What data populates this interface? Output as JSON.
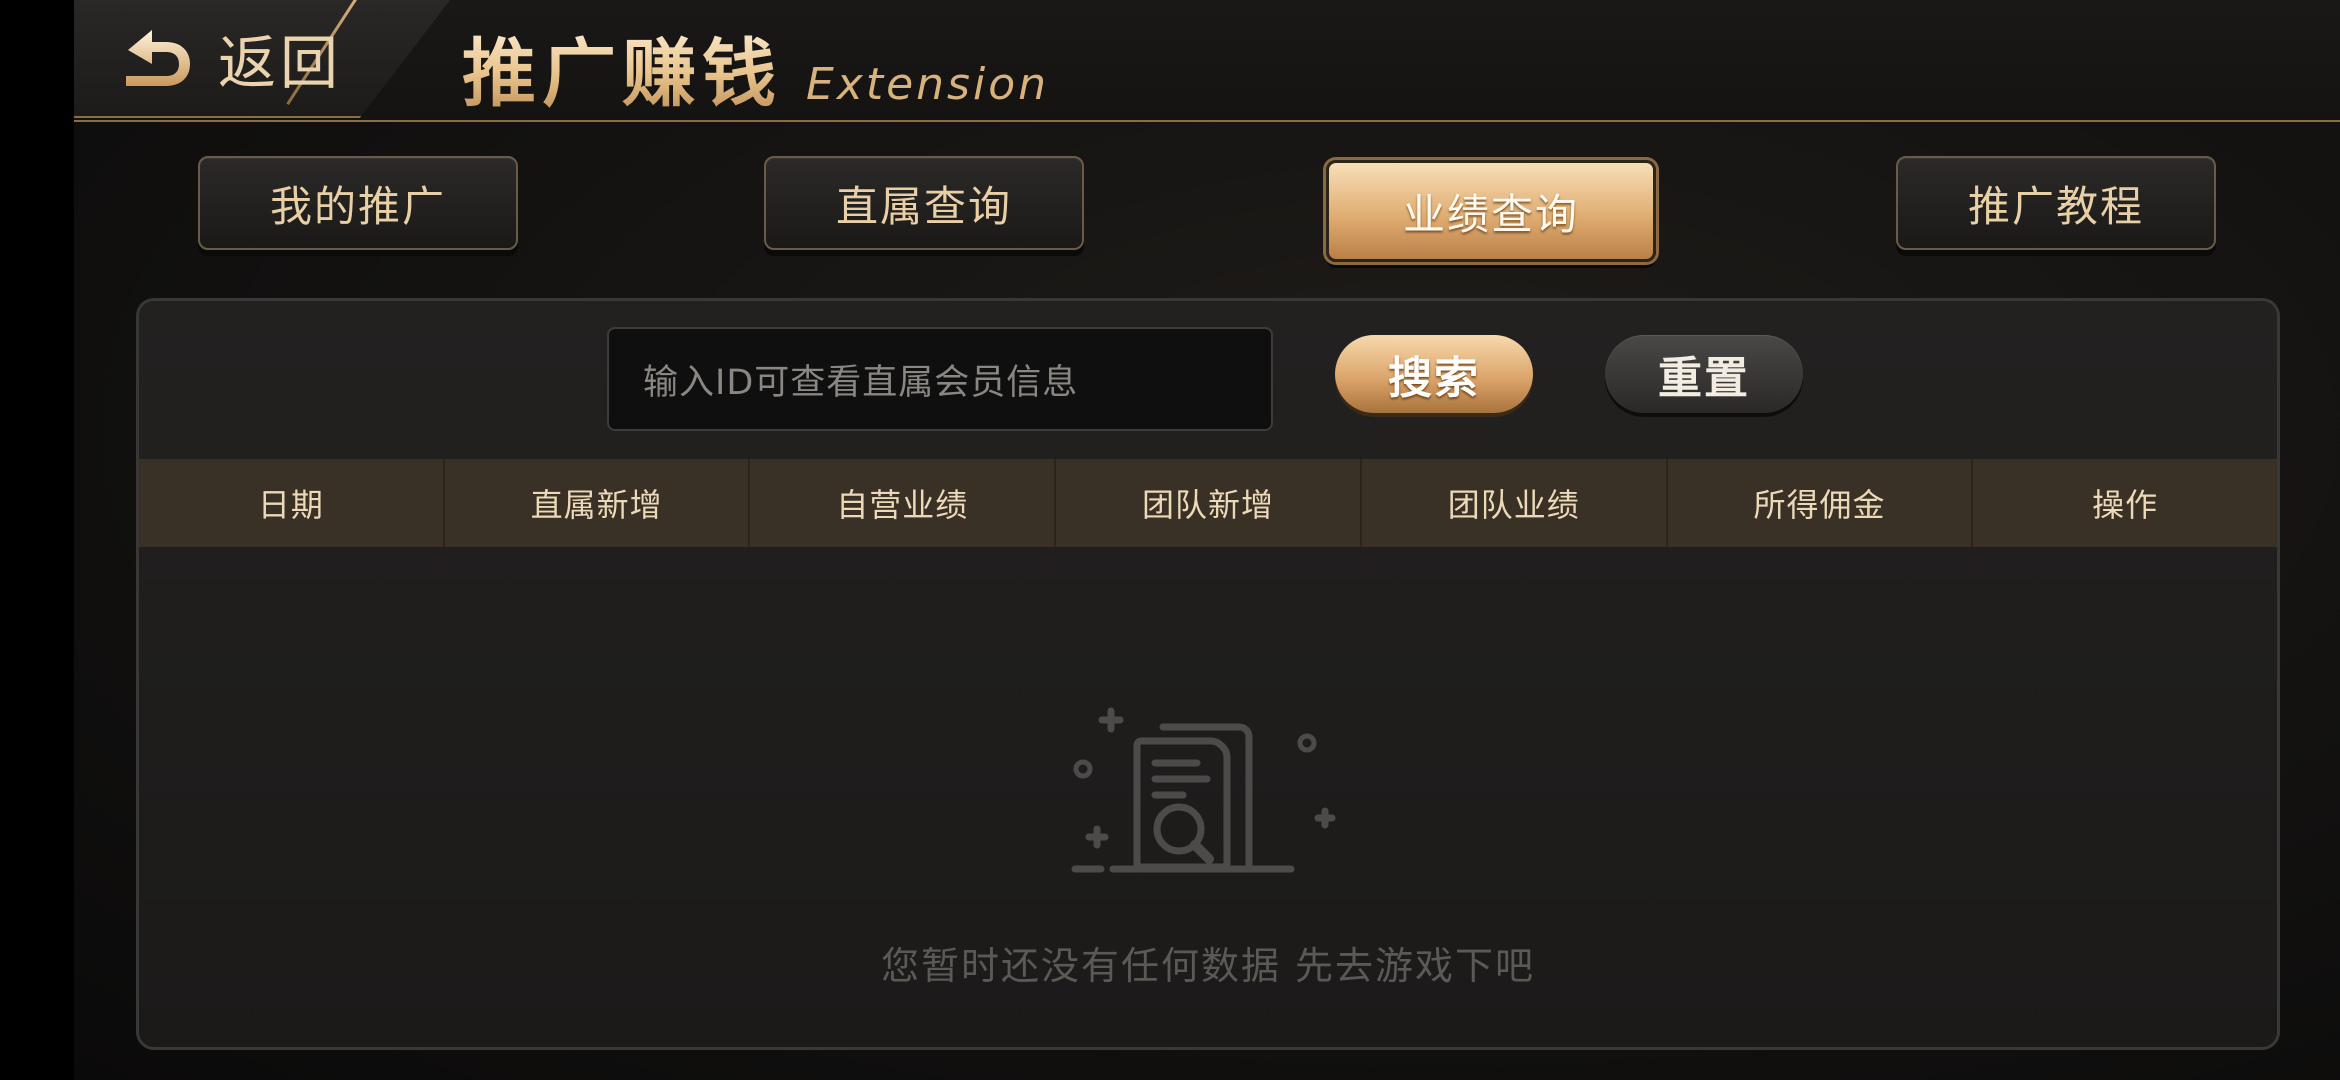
{
  "header": {
    "back_label": "返回",
    "title": "推广赚钱",
    "title_en": "Extension"
  },
  "tabs": [
    {
      "label": "我的推广",
      "active": false
    },
    {
      "label": "直属查询",
      "active": false
    },
    {
      "label": "业绩查询",
      "active": true
    },
    {
      "label": "推广教程",
      "active": false
    }
  ],
  "search": {
    "placeholder": "输入ID可查看直属会员信息",
    "search_label": "搜索",
    "reset_label": "重置"
  },
  "table": {
    "columns": [
      "日期",
      "直属新增",
      "自营业绩",
      "团队新增",
      "团队业绩",
      "所得佣金",
      "操作"
    ],
    "rows": []
  },
  "empty_state": {
    "icon": "empty-document-search-icon",
    "text": "您暂时还没有任何数据 先去游戏下吧"
  },
  "colors": {
    "accent_gold": "#e0ad72",
    "header_line": "#8a6d45",
    "table_header_bg": "#3a3126"
  }
}
